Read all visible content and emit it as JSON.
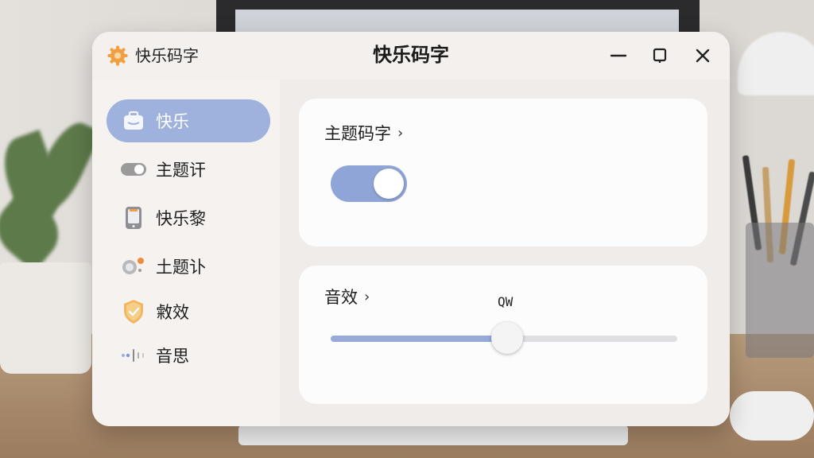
{
  "window": {
    "app_label": "快乐码字",
    "title": "快乐码字",
    "controls": [
      "minimize",
      "maximize",
      "close"
    ]
  },
  "sidebar": {
    "items": [
      {
        "label": "快乐",
        "icon": "briefcase-icon",
        "active": true
      },
      {
        "label": "主题讦",
        "icon": "toggle-icon",
        "active": false
      },
      {
        "label": "快乐黎",
        "icon": "tablet-icon",
        "active": false
      },
      {
        "label": "土题讣",
        "icon": "notification-toggle-icon",
        "active": false
      },
      {
        "label": "敹效",
        "icon": "shield-check-icon",
        "active": false
      },
      {
        "label": "音思",
        "icon": "audio-wave-icon",
        "active": false
      }
    ]
  },
  "cards": {
    "theme": {
      "title": "主题码字",
      "chevron": "›",
      "toggle_on": true
    },
    "sound": {
      "title": "音效",
      "chevron": "›",
      "slider_value_label": "QW",
      "slider_level": 0.51
    }
  },
  "colors": {
    "accent": "#9fb2dd",
    "toggle": "#90a5d7",
    "slider_fill": "#97aad8",
    "icon_orange": "#f0a040"
  }
}
